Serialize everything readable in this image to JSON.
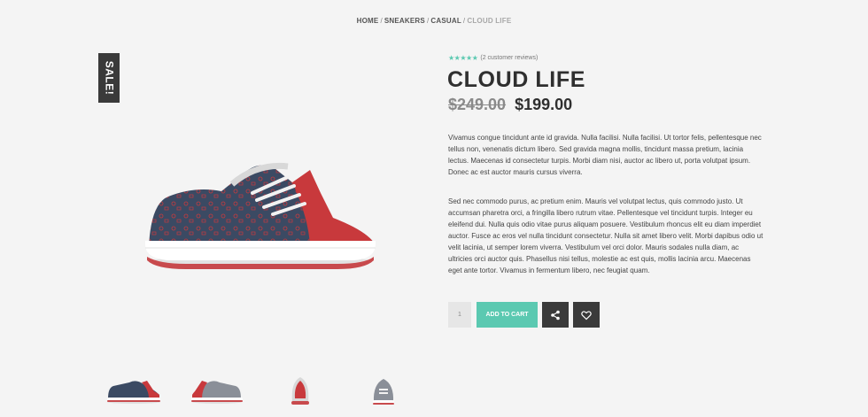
{
  "breadcrumb": {
    "home": "HOME",
    "sneakers": "SNEAKERS",
    "casual": "CASUAL",
    "current": "CLOUD LIFE",
    "separator": "/"
  },
  "badge": {
    "label": "SALE!"
  },
  "product": {
    "stars": "★★★★★",
    "reviews": "(2 customer reviews)",
    "title": "CLOUD LIFE",
    "old_price": "$249.00",
    "new_price": "$199.00",
    "description_1": "Vivamus congue tincidunt ante id gravida. Nulla facilisi. Nulla facilisi. Ut tortor felis, pellentesque nec tellus non, venenatis dictum libero. Sed gravida magna mollis, tincidunt massa pretium, lacinia lectus. Maecenas id consectetur turpis. Morbi diam nisi, auctor ac libero ut, porta volutpat ipsum. Donec ac est auctor mauris cursus viverra.",
    "description_2": "Sed nec commodo purus, ac pretium enim. Mauris vel volutpat lectus, quis commodo justo. Ut accumsan pharetra orci, a fringilla libero rutrum vitae. Pellentesque vel tincidunt turpis. Integer eu eleifend dui. Nulla quis odio vitae purus aliquam posuere. Vestibulum rhoncus elit eu diam imperdiet auctor. Fusce ac eros vel nulla tincidunt consectetur. Nulla sit amet libero velit. Morbi dapibus odio ut velit lacinia, ut semper lorem viverra. Vestibulum vel orci dolor. Mauris sodales nulla diam, ac ultricies orci auctor quis. Phasellus nisi tellus, molestie ac est quis, mollis lacinia arcu. Maecenas eget ante tortor. Vivamus in fermentum libero, nec feugiat quam."
  },
  "actions": {
    "quantity": "1",
    "add_to_cart": "ADD TO CART",
    "share_icon": "share-icon",
    "wishlist_icon": "heart-icon"
  },
  "colors": {
    "accent": "#5bc9b1",
    "dark": "#3a3a3a",
    "background": "#f4f4f4",
    "shoe_navy": "#3b4a63",
    "shoe_red": "#c8393c"
  }
}
